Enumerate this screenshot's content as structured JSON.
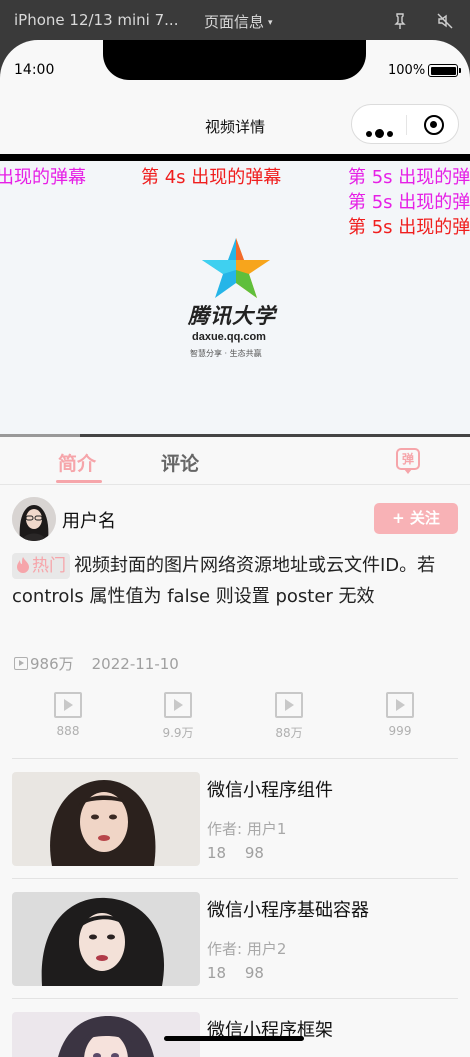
{
  "devtools": {
    "device": "iPhone 12/13 mini 7...",
    "page_info": "页面信息",
    "page_info_caret": "▾"
  },
  "statusbar": {
    "time": "14:00",
    "battery": "100%"
  },
  "navbar": {
    "title": "视频详情",
    "capsule_more": "more-dots-icon",
    "capsule_close": "target-icon"
  },
  "video": {
    "danmaku": [
      {
        "text": "出现的弹幕",
        "color": "#e61fe6"
      },
      {
        "text": "第 4s 出现的弹幕",
        "color": "#f01e1e"
      },
      {
        "text": "第 5s 出现的弹",
        "color": "#e61fe6"
      },
      {
        "text": "第 5s 出现的弹",
        "color": "#e61fe6"
      },
      {
        "text": "第 5s 出现的弹",
        "color": "#f01e1e"
      }
    ],
    "logo": {
      "brand": "腾讯大学",
      "domain": "daxue.qq.com",
      "slogan": "智慧分享 · 生态共赢"
    },
    "progress": 0.17
  },
  "tabs": [
    {
      "label": "简介",
      "active": true
    },
    {
      "label": "评论",
      "active": false
    }
  ],
  "danmu_toggle": {
    "label": "弹"
  },
  "author": {
    "name": "用户名",
    "follow_label": "+ 关注"
  },
  "description": {
    "tag": "热门",
    "text": "视频封面的图片网络资源地址或云文件ID。若 controls 属性值为 false 则设置 poster 无效"
  },
  "meta": {
    "plays": "986万",
    "date": "2022-11-10"
  },
  "actions": [
    {
      "icon": "play-box-icon",
      "count": "888"
    },
    {
      "icon": "play-box-icon",
      "count": "9.9万"
    },
    {
      "icon": "play-box-icon",
      "count": "88万"
    },
    {
      "icon": "play-box-icon",
      "count": "999"
    }
  ],
  "recommendations": [
    {
      "title": "微信小程序组件",
      "author": "作者: 用户1",
      "stats": [
        "18",
        "98"
      ]
    },
    {
      "title": "微信小程序基础容器",
      "author": "作者: 用户2",
      "stats": [
        "18",
        "98"
      ]
    },
    {
      "title": "微信小程序框架",
      "author": "",
      "stats": []
    }
  ],
  "colors": {
    "accent": "#f6a5aa",
    "follow_bg": "#f8b2b6"
  }
}
